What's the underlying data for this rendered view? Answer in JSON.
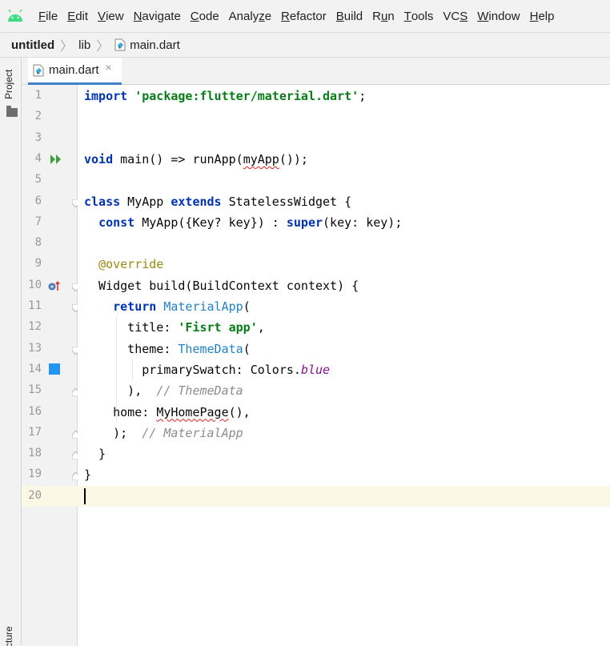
{
  "menubar": {
    "items": [
      {
        "pre": "",
        "mn": "F",
        "post": "ile"
      },
      {
        "pre": "",
        "mn": "E",
        "post": "dit"
      },
      {
        "pre": "",
        "mn": "V",
        "post": "iew"
      },
      {
        "pre": "",
        "mn": "N",
        "post": "avigate"
      },
      {
        "pre": "",
        "mn": "C",
        "post": "ode"
      },
      {
        "pre": "Analy",
        "mn": "z",
        "post": "e"
      },
      {
        "pre": "",
        "mn": "R",
        "post": "efactor"
      },
      {
        "pre": "",
        "mn": "B",
        "post": "uild"
      },
      {
        "pre": "R",
        "mn": "u",
        "post": "n"
      },
      {
        "pre": "",
        "mn": "T",
        "post": "ools"
      },
      {
        "pre": "VC",
        "mn": "S",
        "post": ""
      },
      {
        "pre": "",
        "mn": "W",
        "post": "indow"
      },
      {
        "pre": "",
        "mn": "H",
        "post": "elp"
      }
    ]
  },
  "breadcrumb": {
    "project": "untitled",
    "folder": "lib",
    "file": "main.dart",
    "separator": "〉"
  },
  "toolwindows": {
    "left_top": "Project",
    "left_bottom": "Structure"
  },
  "tabs": [
    {
      "label": "main.dart",
      "close": "×"
    }
  ],
  "editor": {
    "current_line": 20,
    "line_numbers": [
      "1",
      "2",
      "3",
      "4",
      "5",
      "6",
      "7",
      "8",
      "9",
      "10",
      "11",
      "12",
      "13",
      "14",
      "15",
      "16",
      "17",
      "18",
      "19",
      "20"
    ],
    "lines": [
      [
        {
          "t": "import",
          "c": "kw"
        },
        {
          "t": " "
        },
        {
          "t": "'package:flutter/material.dart'",
          "c": "str"
        },
        {
          "t": ";"
        }
      ],
      [],
      [],
      [
        {
          "t": "void",
          "c": "kw"
        },
        {
          "t": " main() => runApp("
        },
        {
          "t": "myApp",
          "c": "squig"
        },
        {
          "t": "());"
        }
      ],
      [],
      [
        {
          "t": "class",
          "c": "kw"
        },
        {
          "t": " MyApp "
        },
        {
          "t": "extends",
          "c": "kw"
        },
        {
          "t": " StatelessWidget {"
        }
      ],
      [
        {
          "t": "  "
        },
        {
          "t": "const",
          "c": "kw"
        },
        {
          "t": " MyApp({Key? key}) : "
        },
        {
          "t": "super",
          "c": "kw"
        },
        {
          "t": "(key: key);"
        }
      ],
      [],
      [
        {
          "t": "  "
        },
        {
          "t": "@override",
          "c": "ann"
        }
      ],
      [
        {
          "t": "  Widget build(BuildContext context) {"
        }
      ],
      [
        {
          "t": "    "
        },
        {
          "t": "return",
          "c": "kw"
        },
        {
          "t": " "
        },
        {
          "t": "MaterialApp",
          "c": "cls"
        },
        {
          "t": "("
        }
      ],
      [
        {
          "t": "      title: "
        },
        {
          "t": "'Fisrt app'",
          "c": "str"
        },
        {
          "t": ","
        }
      ],
      [
        {
          "t": "      theme: "
        },
        {
          "t": "ThemeData",
          "c": "cls"
        },
        {
          "t": "("
        }
      ],
      [
        {
          "t": "        primarySwatch: Colors."
        },
        {
          "t": "blue",
          "c": "ital"
        }
      ],
      [
        {
          "t": "      ),  "
        },
        {
          "t": "// ThemeData",
          "c": "cmt"
        }
      ],
      [
        {
          "t": "    home: "
        },
        {
          "t": "MyHomePage",
          "c": "squig"
        },
        {
          "t": "(),"
        }
      ],
      [
        {
          "t": "    );  "
        },
        {
          "t": "// MaterialApp",
          "c": "cmt"
        }
      ],
      [
        {
          "t": "  }"
        }
      ],
      [
        {
          "t": "}"
        }
      ],
      []
    ]
  },
  "colors": {
    "keyword": "#0033b3",
    "string": "#067d17",
    "class_ref": "#1f83cc",
    "comment": "#8c8c8c",
    "annotation": "#9e880d",
    "static_field": "#871094",
    "error_underline": "#e0201d",
    "current_line_bg": "#fcf8e6",
    "color_swatch_blue": "#2196f3",
    "run_icon": "#3e9f3e",
    "android_logo": "#3ddc84",
    "tab_underline": "#4083c9"
  },
  "gutter_icons": [
    {
      "line": 4,
      "name": "run-icon"
    },
    {
      "line": 10,
      "name": "override-icon"
    },
    {
      "line": 14,
      "name": "color-swatch-icon"
    }
  ]
}
